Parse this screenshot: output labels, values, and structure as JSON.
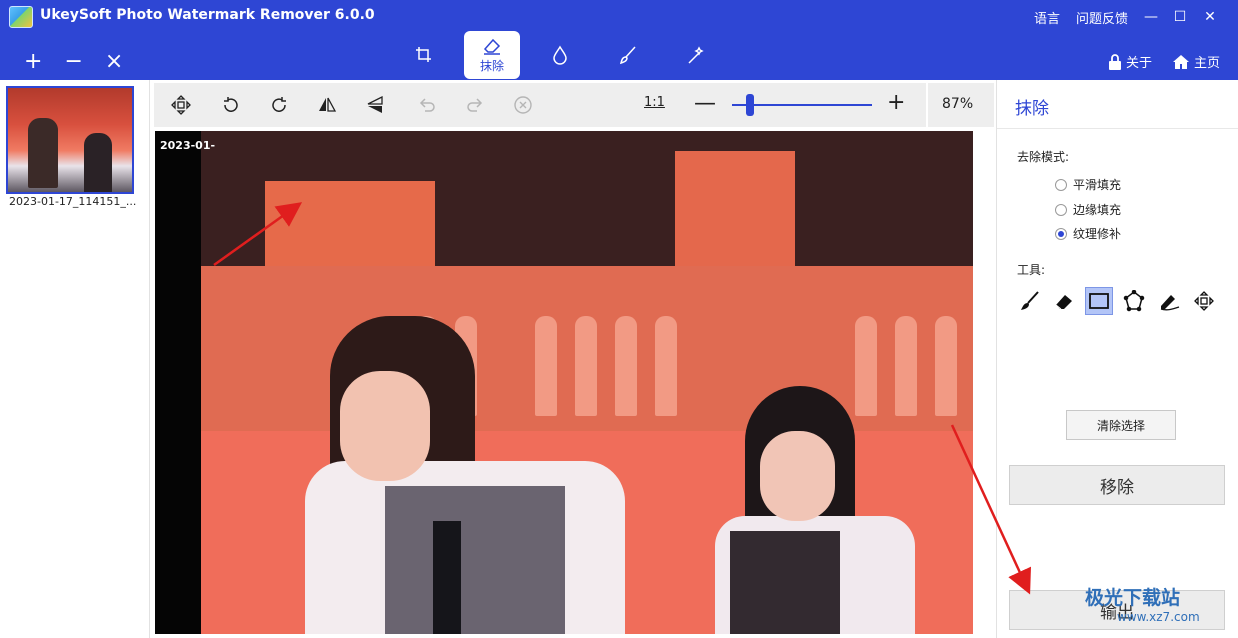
{
  "app": {
    "title": "UkeySoft Photo Watermark Remover 6.0.0"
  },
  "top_links": {
    "language": "语言",
    "feedback": "问题反馈"
  },
  "window_controls": {
    "minimize": "—",
    "maximize": "☐",
    "close": "✕"
  },
  "file_ops": {
    "add": "+",
    "remove": "−",
    "clear": "×"
  },
  "tool_tabs": [
    {
      "icon": "crop-icon",
      "label": ""
    },
    {
      "icon": "eraser-icon",
      "label": "抹除",
      "active": true
    },
    {
      "icon": "drop-icon",
      "label": ""
    },
    {
      "icon": "brush-icon",
      "label": ""
    },
    {
      "icon": "wand-icon",
      "label": ""
    }
  ],
  "header_right": {
    "about": "关于",
    "home": "主页"
  },
  "thumbnails": [
    {
      "label": "2023-01-17_114151_..."
    }
  ],
  "canvas_toolbar": {
    "ratio_label": "1:1",
    "zoom_minus": "—",
    "zoom_plus": "+",
    "zoom_value": "87%",
    "zoom_level": 0.13,
    "buttons": [
      "move-icon",
      "rotate-left-icon",
      "rotate-right-icon",
      "flip-horizontal-icon",
      "flip-vertical-icon",
      "undo-icon",
      "redo-icon",
      "clear-all-icon"
    ]
  },
  "canvas": {
    "timestamp_text": "2023-01-"
  },
  "right_panel": {
    "title": "抹除",
    "mode_label": "去除模式:",
    "modes": [
      {
        "label": "平滑填充",
        "selected": false
      },
      {
        "label": "边缘填充",
        "selected": false
      },
      {
        "label": "纹理修补",
        "selected": true
      }
    ],
    "tools_label": "工具:",
    "tools": [
      "brush-icon",
      "eraser-icon",
      "rectangle-select-icon",
      "polygon-select-icon",
      "lasso-pen-icon",
      "move-icon"
    ],
    "clear_selection": "清除选择",
    "remove": "移除",
    "export": "输出"
  },
  "watermark": {
    "brand": "极光下载站",
    "url": "www.xz7.com"
  },
  "colors": {
    "header": "#2e46d4",
    "accent": "#2e46d4",
    "arrow": "#e01e1e"
  }
}
